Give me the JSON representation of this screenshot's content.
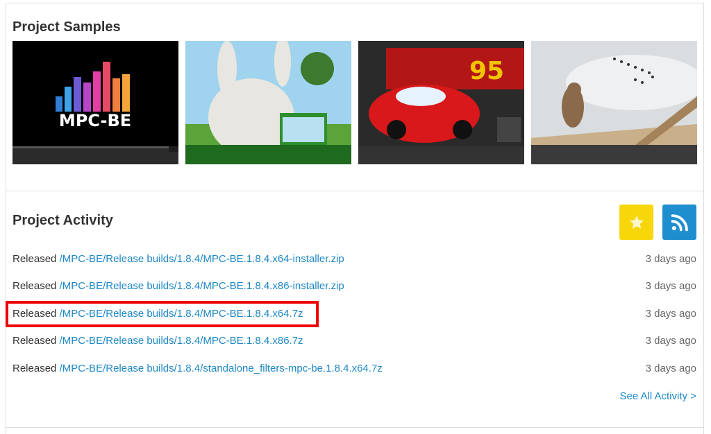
{
  "samples": {
    "title": "Project Samples",
    "items": [
      {
        "name": "mpc-be-logo-sample",
        "logo_text": "MPC-BE"
      },
      {
        "name": "bunny-sample"
      },
      {
        "name": "cars-sample",
        "badge": "95"
      },
      {
        "name": "bird-sample"
      }
    ]
  },
  "activity": {
    "title": "Project Activity",
    "items": [
      {
        "action": "Released",
        "path": "/MPC-BE/Release builds/1.8.4/MPC-BE.1.8.4.x64-installer.zip",
        "time": "3 days ago"
      },
      {
        "action": "Released",
        "path": "/MPC-BE/Release builds/1.8.4/MPC-BE.1.8.4.x86-installer.zip",
        "time": "3 days ago"
      },
      {
        "action": "Released",
        "path": "/MPC-BE/Release builds/1.8.4/MPC-BE.1.8.4.x64.7z",
        "time": "3 days ago"
      },
      {
        "action": "Released",
        "path": "/MPC-BE/Release builds/1.8.4/MPC-BE.1.8.4.x86.7z",
        "time": "3 days ago"
      },
      {
        "action": "Released",
        "path": "/MPC-BE/Release builds/1.8.4/standalone_filters-mpc-be.1.8.4.x64.7z",
        "time": "3 days ago"
      }
    ],
    "see_all": "See All Activity >",
    "icons": {
      "favorite": "star-icon",
      "feed": "rss-icon"
    },
    "colors": {
      "favorite": "#f7d70a",
      "feed": "#1f8ecf",
      "link": "#1e88c7",
      "highlight": "#ee0000"
    }
  }
}
